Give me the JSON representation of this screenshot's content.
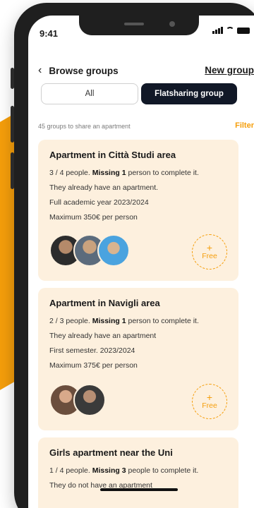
{
  "status": {
    "time": "9:41"
  },
  "nav": {
    "title": "Browse groups",
    "right_link": "New group"
  },
  "tabs": [
    {
      "label": "All",
      "active": false
    },
    {
      "label": "Flatsharing group",
      "active": true
    }
  ],
  "list_meta": {
    "summary": "45 groups to share an apartment",
    "filter_label": "Filter"
  },
  "groups": [
    {
      "title": "Apartment in Città Studi area",
      "people": "3 / 4 people.",
      "missing": "Missing 1",
      "missing_suffix": "person to complete it.",
      "line2": "They already have an apartment.",
      "line3": "Full academic year 2023/2024",
      "line4": "Maximum 350€ per person",
      "free_label": "Free"
    },
    {
      "title": "Apartment in Navigli area",
      "people": "2 / 3 people.",
      "missing": "Missing 1",
      "missing_suffix": "person to complete it.",
      "line2": "They already have an apartment",
      "line3": "First semester. 2023/2024",
      "line4": "Maximum 375€ per person",
      "free_label": "Free"
    },
    {
      "title": "Girls apartment near the Uni",
      "people": "1 / 4 people.",
      "missing": "Missing 3",
      "missing_suffix": "people to complete it.",
      "line2": "They do not have an apartment"
    }
  ],
  "colors": {
    "accent": "#f59e0b",
    "card_bg": "#fdf0de",
    "dark": "#111827"
  },
  "icons": {
    "back": "chevron-left-icon",
    "add": "plus-icon"
  }
}
